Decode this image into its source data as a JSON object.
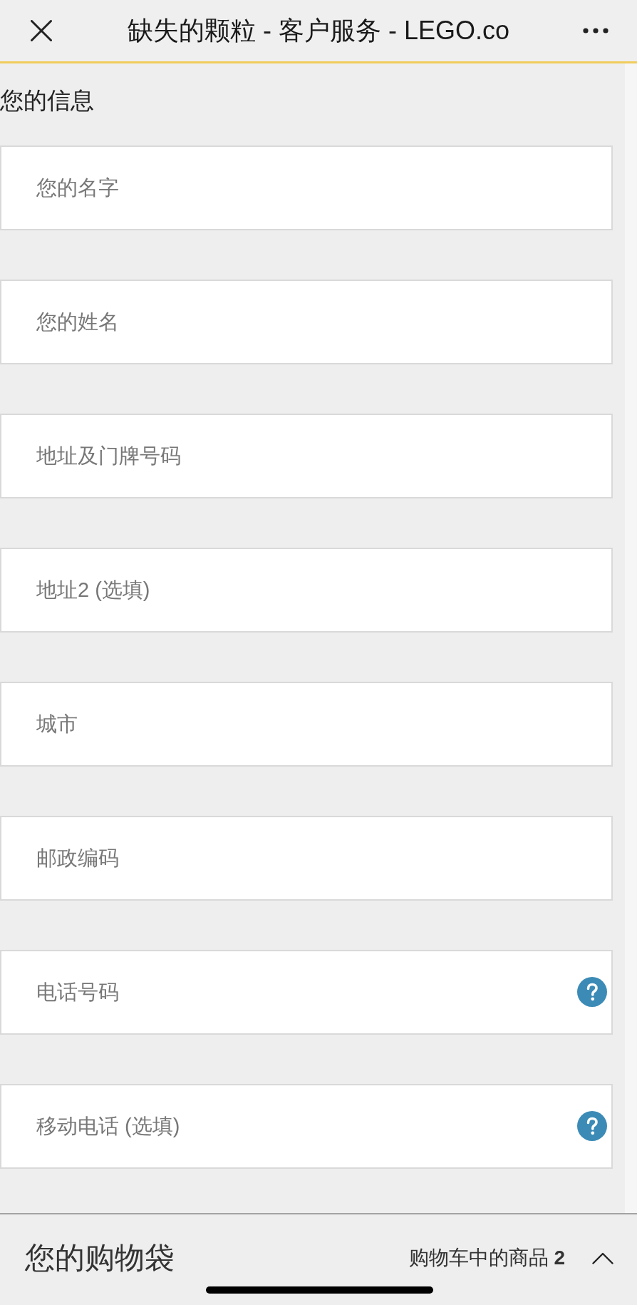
{
  "header": {
    "title": "缺失的颗粒 - 客户服务 - LEGO.co"
  },
  "section": {
    "title": "您的信息"
  },
  "fields": [
    {
      "placeholder": "您的名字",
      "help": false
    },
    {
      "placeholder": "您的姓名",
      "help": false
    },
    {
      "placeholder": "地址及门牌号码",
      "help": false
    },
    {
      "placeholder": "地址2 (选填)",
      "help": false
    },
    {
      "placeholder": "城市",
      "help": false
    },
    {
      "placeholder": "邮政编码",
      "help": false
    },
    {
      "placeholder": "电话号码",
      "help": true
    },
    {
      "placeholder": "移动电话 (选填)",
      "help": true
    }
  ],
  "bag_bar": {
    "title": "您的购物袋",
    "count_label": "购物车中的商品 **2**",
    "expanded": false
  }
}
